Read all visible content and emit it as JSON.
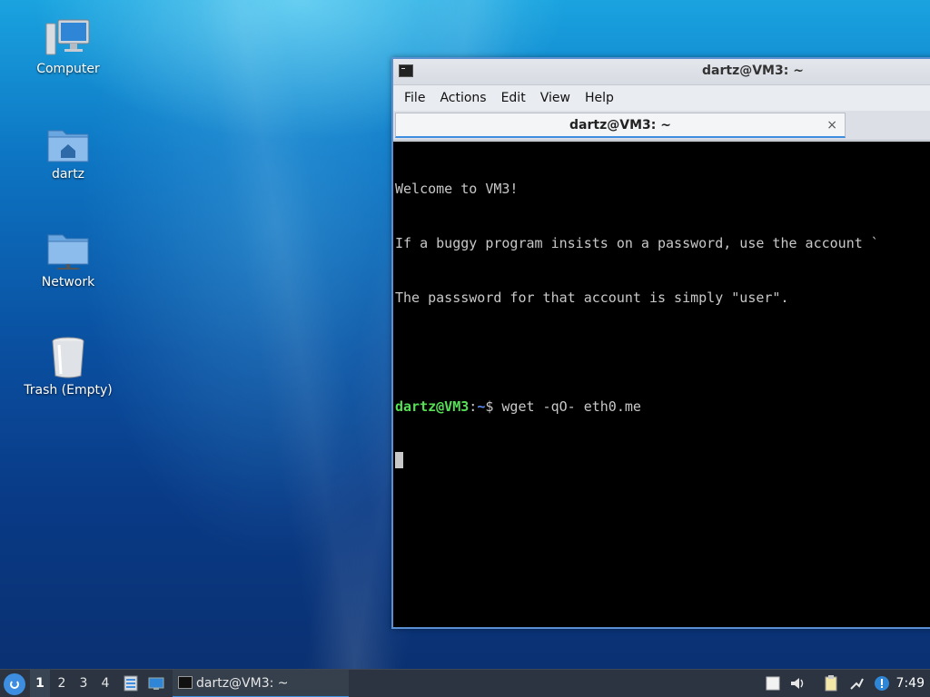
{
  "desktop": {
    "icons": [
      {
        "label": "Computer"
      },
      {
        "label": "dartz"
      },
      {
        "label": "Network"
      },
      {
        "label": "Trash (Empty)"
      }
    ]
  },
  "window": {
    "title": "dartz@VM3: ~",
    "menu": [
      "File",
      "Actions",
      "Edit",
      "View",
      "Help"
    ],
    "tab_title": "dartz@VM3: ~",
    "tab_close": "×",
    "terminal": {
      "lines": [
        "Welcome to VM3!",
        "If a buggy program insists on a password, use the account `",
        "The passsword for that account is simply \"user\".",
        ""
      ],
      "prompt_user": "dartz@VM3",
      "prompt_sep": ":",
      "prompt_path": "~",
      "prompt_symbol": "$ ",
      "command": "wget -qO- eth0.me"
    }
  },
  "taskbar": {
    "workspaces": [
      "1",
      "2",
      "3",
      "4"
    ],
    "active_workspace": "1",
    "task_label": "dartz@VM3: ~",
    "clock": "7:49",
    "tray_icons": [
      "clipboard-icon",
      "volume-icon",
      "notes-icon",
      "network-icon",
      "update-alert-icon"
    ]
  },
  "colors": {
    "accent": "#3d8ee0",
    "prompt_user": "#55e055",
    "prompt_path": "#5c8cf0",
    "terminal_bg": "#000000"
  }
}
